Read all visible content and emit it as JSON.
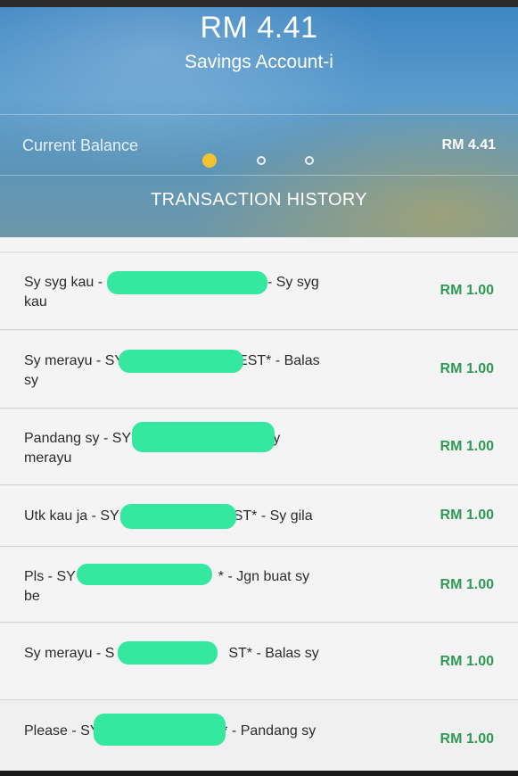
{
  "header": {
    "amount": "RM 4.41",
    "account_name": "Savings Account-i",
    "balance_label": "Current Balance",
    "balance_value": "RM 4.41",
    "carousel_dots": {
      "count": 3,
      "active_index": 0,
      "active_color": "#f2c230"
    },
    "history_title": "TRANSACTION HISTORY"
  },
  "colors": {
    "amount_green": "#2e9a55",
    "redaction": "#34e8a0"
  },
  "transactions": [
    {
      "description": "Sy syg kau - SY        ST* - Sy syg kau",
      "amount": "RM 1.00"
    },
    {
      "description": "Sy merayu - SY        EST* - Balas sy",
      "amount": "RM 1.00"
    },
    {
      "description": "Pandang sy - SY        * - Sy merayu",
      "amount": "RM 1.00"
    },
    {
      "description": "Utk kau ja - SY        ST* - Sy gila",
      "amount": "RM 1.00"
    },
    {
      "description": "Pls - SY          * - Jgn buat sy be",
      "amount": "RM 1.00"
    },
    {
      "description": "Sy merayu - S        ST* - Balas sy",
      "amount": "RM 1.00"
    },
    {
      "description": "Please - SY        T* - Pandang sy",
      "amount": "RM 1.00"
    }
  ]
}
